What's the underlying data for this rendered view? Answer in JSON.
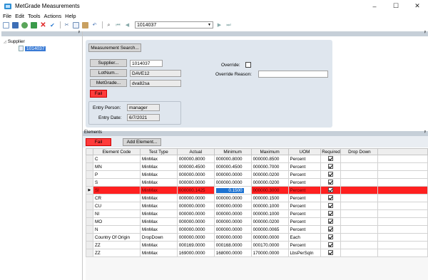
{
  "window": {
    "title": "MetGrade Measurements",
    "min_label": "–",
    "max_label": "☐",
    "close_label": "✕"
  },
  "menu": [
    "File",
    "Edit",
    "Tools",
    "Actions",
    "Help"
  ],
  "toolbar": {
    "combo_value": "1014037",
    "icons": [
      "new-icon",
      "save-icon",
      "refresh-icon",
      "export-icon",
      "delete-icon",
      "check-icon",
      "cut-icon",
      "copy-icon",
      "paste-icon",
      "undo-icon",
      "find-icon",
      "first-record-icon",
      "previous-record-icon",
      "next-record-icon",
      "last-record-icon"
    ]
  },
  "left_panel": {
    "pin": "ᵖ",
    "tree_root": "Supplier",
    "tree_child": "1014037"
  },
  "top_panel": {
    "pin": "ᵖ",
    "search_button": "Measurement Search...",
    "supplier_button": "Supplier...",
    "supplier_value": "1014037",
    "lotnum_button": "LotNum...",
    "lotnum_value": "DAVE12",
    "metgrade_button": "MetGrade...",
    "metgrade_value": "dva82sa",
    "status_button": "Fail",
    "override_label": "Override:",
    "override_reason_label": "Override Reason:",
    "override_reason_value": "",
    "entry_person_label": "Entry Person:",
    "entry_person_value": "manager",
    "entry_date_label": "Entry Date:",
    "entry_date_value": "6/7/2021"
  },
  "elements": {
    "title": "Elements",
    "pin": "ᵖ",
    "fail_button": "Fail",
    "add_button": "Add Element...",
    "columns": [
      "Element Code",
      "Test Type",
      "Actual",
      "Minimum",
      "Maximum",
      "UOM",
      "Required",
      "Drop Down",
      ""
    ],
    "rows": [
      {
        "code": "C",
        "type": "MinMax",
        "actual": "000000.8000",
        "min": "000000.8000",
        "max": "000000.8500",
        "uom": "Percent"
      },
      {
        "code": "MN",
        "type": "MinMax",
        "actual": "000000.4500",
        "min": "000000.4500",
        "max": "000000.7000",
        "uom": "Percent"
      },
      {
        "code": "P",
        "type": "MinMax",
        "actual": "000000.0000",
        "min": "000000.0000",
        "max": "000000.0200",
        "uom": "Percent"
      },
      {
        "code": "S",
        "type": "MinMax",
        "actual": "000000.0000",
        "min": "000000.0000",
        "max": "000000.0200",
        "uom": "Percent"
      },
      {
        "code": "SI",
        "type": "MinMax",
        "actual": "000000.1425",
        "min": "0.1500",
        "max": "000000.3000",
        "uom": "Percent"
      },
      {
        "code": "CR",
        "type": "MinMax",
        "actual": "000000.0000",
        "min": "000000.0000",
        "max": "000000.1500",
        "uom": "Percent"
      },
      {
        "code": "CU",
        "type": "MinMax",
        "actual": "000000.0000",
        "min": "000000.0000",
        "max": "000000.1000",
        "uom": "Percent"
      },
      {
        "code": "NI",
        "type": "MinMax",
        "actual": "000000.0000",
        "min": "000000.0000",
        "max": "000000.1000",
        "uom": "Percent"
      },
      {
        "code": "MO",
        "type": "MinMax",
        "actual": "000000.0000",
        "min": "000000.0000",
        "max": "000000.0200",
        "uom": "Percent"
      },
      {
        "code": "N",
        "type": "MinMax",
        "actual": "000000.0000",
        "min": "000000.0000",
        "max": "000000.0065",
        "uom": "Percent"
      },
      {
        "code": "Country Of Origin",
        "type": "DropDown",
        "actual": "000000.0000",
        "min": "000000.0000",
        "max": "000000.0000",
        "uom": "Each"
      },
      {
        "code": "ZZ",
        "type": "MinMax",
        "actual": "000169.0000",
        "min": "000168.0000",
        "max": "000170.0000",
        "uom": "Percent"
      },
      {
        "code": "ZZ",
        "type": "MinMax",
        "actual": "169000.0000",
        "min": "168000.0000",
        "max": "170000.0000",
        "uom": "LbsPerSqIn"
      }
    ],
    "selected_row_index": 4,
    "row_marker": "▶"
  },
  "colors": {
    "fail_red": "#ff3b3b",
    "selection_blue": "#1e73d2",
    "form_background": "#dfe6ee",
    "panel_header": "#c6cfd8"
  }
}
